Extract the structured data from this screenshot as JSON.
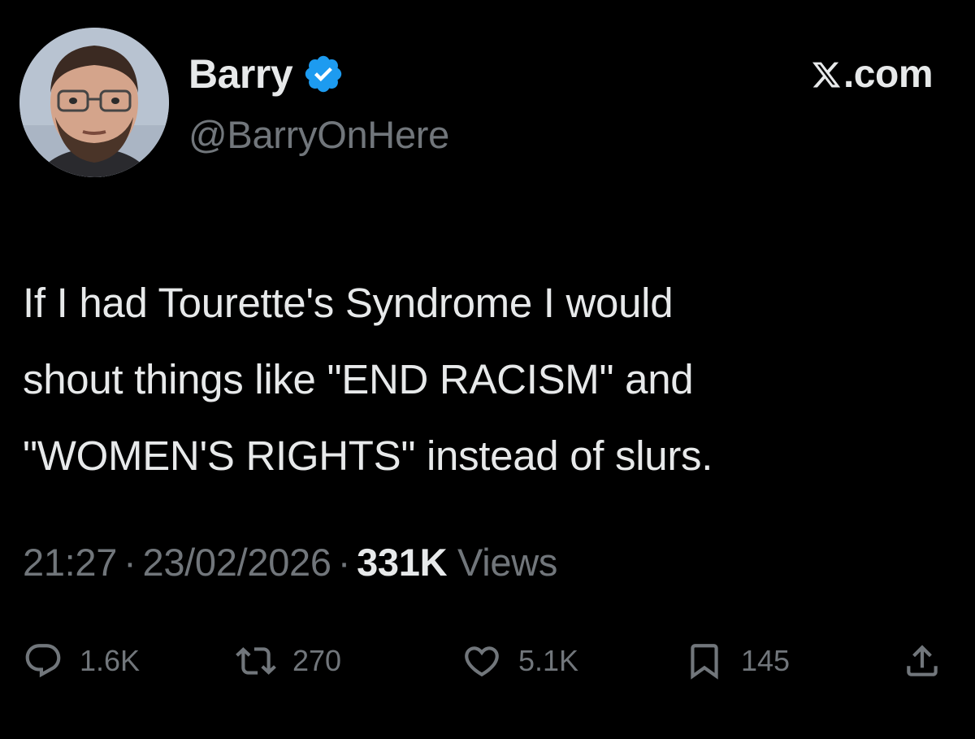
{
  "author": {
    "display_name": "Barry",
    "handle": "@BarryOnHere",
    "verified": true,
    "verified_color": "#1d9bf0",
    "avatar_icon": "profile-photo"
  },
  "brand": {
    "domain": ".com",
    "logo_icon": "x-logo-icon"
  },
  "tweet": {
    "lines": [
      "If I had Tourette's Syndrome I would",
      "shout things like \"END RACISM\" and",
      "\"WOMEN'S RIGHTS\" instead of slurs."
    ]
  },
  "meta": {
    "time": "21:27",
    "separator": "·",
    "date": "23/02/2026",
    "views_count": "331K",
    "views_label": "Views"
  },
  "actions": {
    "replies": {
      "icon": "reply-icon",
      "count": "1.6K"
    },
    "reposts": {
      "icon": "repost-icon",
      "count": "270"
    },
    "likes": {
      "icon": "heart-icon",
      "count": "5.1K"
    },
    "bookmarks": {
      "icon": "bookmark-icon",
      "count": "145"
    },
    "share": {
      "icon": "share-icon"
    }
  },
  "colors": {
    "background": "#000000",
    "primary_text": "#e7e9ea",
    "secondary_text": "#71767b"
  }
}
